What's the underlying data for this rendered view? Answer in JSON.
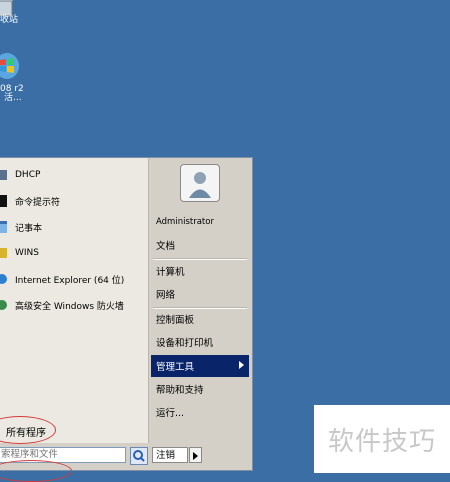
{
  "desktop": {
    "icons": [
      {
        "label_lines": [
          "收站"
        ],
        "icon": "recycle-bin-icon"
      },
      {
        "label_lines": [
          "08 r2",
          "活..."
        ],
        "icon": "windows-server-icon"
      }
    ]
  },
  "start_menu": {
    "programs": [
      {
        "label": "DHCP",
        "icon": "dhcp-icon"
      },
      {
        "label": "命令提示符",
        "icon": "command-prompt-icon"
      },
      {
        "label": "记事本",
        "icon": "notepad-icon"
      },
      {
        "label": "WINS",
        "icon": "wins-icon"
      },
      {
        "label": "Internet Explorer (64 位)",
        "icon": "internet-explorer-icon"
      },
      {
        "label": "高级安全 Windows 防火墙",
        "icon": "firewall-icon"
      }
    ],
    "all_programs": "所有程序",
    "search_placeholder": "索程序和文件",
    "right_items": {
      "user": "Administrator",
      "documents": "文档",
      "computer": "计算机",
      "network": "网络",
      "control_panel": "控制面板",
      "devices_printers": "设备和打印机",
      "admin_tools": "管理工具",
      "help_support": "帮助和支持",
      "run": "运行..."
    },
    "logoff_label": "注销",
    "highlight_color": "#0a246a"
  },
  "watermark": "软件技巧"
}
